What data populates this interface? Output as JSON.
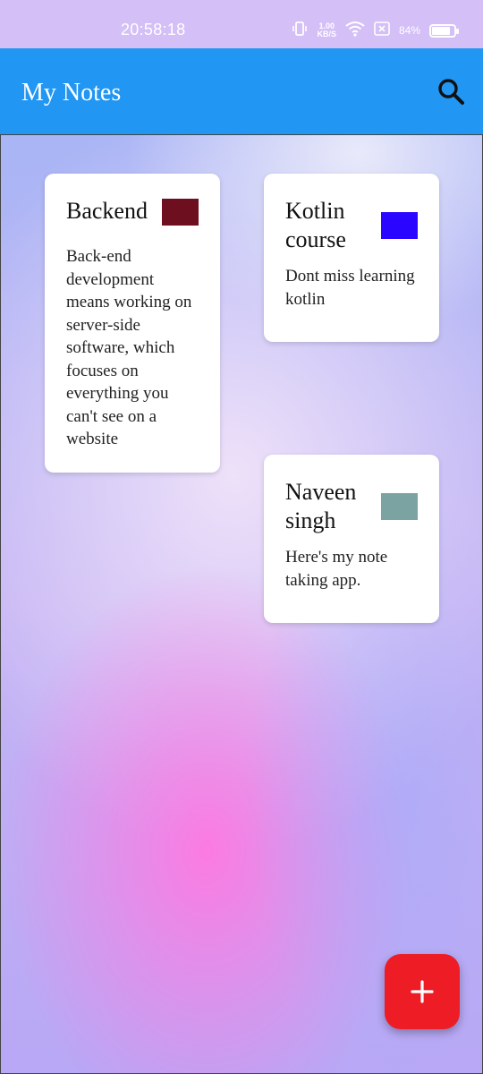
{
  "status_bar": {
    "time": "20:58:18",
    "net_speed_value": "1.00",
    "net_speed_unit": "KB/S",
    "battery_percent": "84%",
    "battery_level": 0.84
  },
  "app_bar": {
    "title": "My Notes",
    "color": "#2196f3"
  },
  "notes": [
    {
      "title": "Backend",
      "body": "Back-end development means working on server-side software, which focuses on everything you can't see on a website",
      "color": "#6d0f1f"
    },
    {
      "title": "Kotlin course",
      "body": "Dont miss learning kotlin",
      "color": "#2a05ff"
    },
    {
      "title": "Naveen singh",
      "body": "Here's my note taking app.",
      "color": "#7aa3a1"
    }
  ],
  "fab": {
    "icon": "plus-icon",
    "color": "#ee1c25"
  }
}
